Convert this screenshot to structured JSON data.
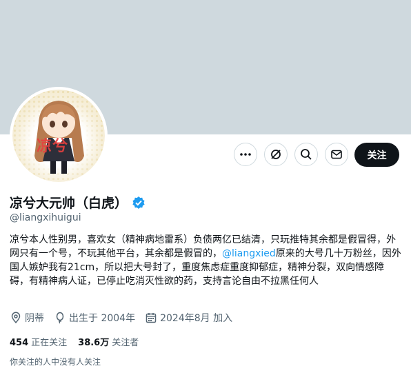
{
  "profile": {
    "display_name": "凉兮大元帅（白虎）",
    "handle": "@liangxihuigui",
    "avatar_text": "凉兮",
    "bio": {
      "part1": "凉兮本人性别男，喜欢女（精神病地雷系）负债两亿已结清，只玩推特其余都是假冒得，外网只有一个号，不玩其他平台，其余都是假冒的，",
      "mention": "@liangxied",
      "part2": "原来的大号几十万粉丝，因外国人嫉妒我有21cm，所以把大号封了，重度焦虑症重度抑郁症，精神分裂，双向情感障碍，有精神病人证，已停止吃消灭性欲的药，支持言论自由不拉黑任何人"
    },
    "location": "阴蒂",
    "birthday": "出生于 2004年",
    "joined": "2024年8月 加入",
    "following_count": "454",
    "following_label": "正在关注",
    "followers_count": "38.6万",
    "followers_label": "关注者",
    "followed_by_note": "你关注的人中没有人关注"
  },
  "actions": {
    "more_icon": "more-icon",
    "grok_icon": "grok-icon",
    "search_icon": "search-icon",
    "message_icon": "mail-icon",
    "follow_label": "关注"
  },
  "colors": {
    "banner": "#cfd9de",
    "accent": "#1d9bf0",
    "follow_button": "#0f1419",
    "muted_text": "#536471"
  }
}
